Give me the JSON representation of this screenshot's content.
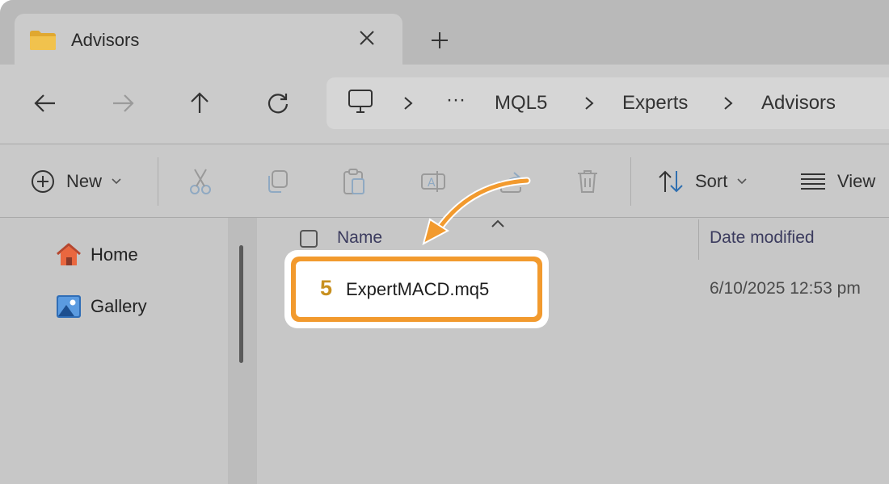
{
  "tab": {
    "title": "Advisors"
  },
  "breadcrumb": {
    "overflow": "···",
    "items": [
      "MQL5",
      "Experts",
      "Advisors"
    ]
  },
  "commands": {
    "new_label": "New",
    "sort_label": "Sort",
    "view_label": "View"
  },
  "sidebar": {
    "items": [
      {
        "label": "Home",
        "icon": "home-icon"
      },
      {
        "label": "Gallery",
        "icon": "gallery-icon"
      }
    ]
  },
  "columns": {
    "name": "Name",
    "date_modified": "Date modified"
  },
  "files": [
    {
      "icon_glyph": "5",
      "name": "ExpertMACD.mq5",
      "date_modified": "6/10/2025 12:53 pm"
    }
  ],
  "colors": {
    "highlight": "#f29a2e",
    "file_icon": "#c8901f",
    "annotation_arrow": "#f29a2e"
  }
}
